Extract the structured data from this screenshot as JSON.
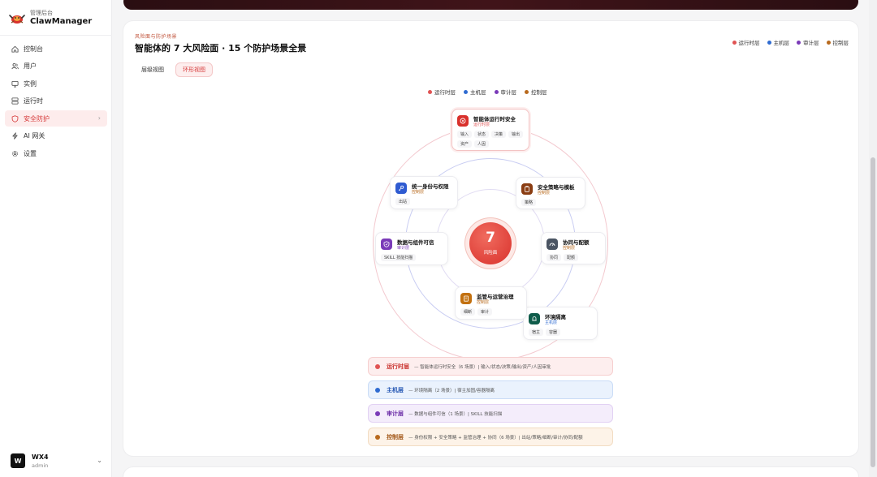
{
  "colors": {
    "runtime": "#e05353",
    "host": "#2f6bd1",
    "audit": "#7a3ab8",
    "control": "#b86a1e",
    "accent": "#d63a3a"
  },
  "sidebar": {
    "brand_sub": "管理后台",
    "brand_title": "ClawManager",
    "items": [
      {
        "label": "控制台",
        "icon": "home-icon"
      },
      {
        "label": "用户",
        "icon": "users-icon"
      },
      {
        "label": "实例",
        "icon": "monitor-icon"
      },
      {
        "label": "运行时",
        "icon": "server-icon"
      },
      {
        "label": "安全防护",
        "icon": "shield-icon",
        "active": true
      },
      {
        "label": "AI 网关",
        "icon": "lightning-icon"
      },
      {
        "label": "设置",
        "icon": "gear-icon"
      }
    ],
    "user": {
      "avatar": "W",
      "name": "WX4",
      "role": "admin"
    }
  },
  "card": {
    "eyebrow": "风险面与防护场景",
    "title": "智能体的 7 大风险面 · 15 个防护场景全景",
    "legend": [
      {
        "label": "运行时层",
        "color": "#e05353"
      },
      {
        "label": "主机层",
        "color": "#2f6bd1"
      },
      {
        "label": "审计层",
        "color": "#7a3ab8"
      },
      {
        "label": "控制层",
        "color": "#b86a1e"
      }
    ],
    "tabs": [
      {
        "label": "层级视图",
        "active": false
      },
      {
        "label": "环形视图",
        "active": true
      }
    ]
  },
  "diagram": {
    "center_number": "7",
    "center_label": "风险面",
    "nodes": [
      {
        "title": "智能体运行时安全",
        "layer": "运行时层",
        "color": "#e05353",
        "icon_bg": "#d9312c",
        "tags": [
          "输入",
          "状态",
          "决策",
          "输出",
          "资产",
          "人因"
        ]
      },
      {
        "title": "安全策略与模板",
        "layer": "控制层",
        "color": "#b86a1e",
        "icon_bg": "#8a3d12",
        "tags": [
          "策略"
        ]
      },
      {
        "title": "协同与配额",
        "layer": "控制层",
        "color": "#b86a1e",
        "icon_bg": "#4b5563",
        "tags": [
          "协同",
          "配额"
        ]
      },
      {
        "title": "环境隔离",
        "layer": "主机层",
        "color": "#2f6bd1",
        "icon_bg": "#0f5c4a",
        "tags": [
          "宿主",
          "容器"
        ]
      },
      {
        "title": "监管与运营治理",
        "layer": "控制层",
        "color": "#b86a1e",
        "icon_bg": "#c2700f",
        "tags": [
          "细断",
          "审计"
        ]
      },
      {
        "title": "数据与组件可信",
        "layer": "审计层",
        "color": "#7a3ab8",
        "icon_bg": "#7a3ab8",
        "tags": [
          "SKILL 技能扫描"
        ]
      },
      {
        "title": "统一身份与权限",
        "layer": "控制层",
        "color": "#b86a1e",
        "icon_bg": "#2f5bd1",
        "tags": [
          "出站"
        ]
      }
    ]
  },
  "rows": [
    {
      "name": "运行时层",
      "desc": "— 智能体运行时安全（6 场景）| 输入/状态/决策/输出/资产/人因审批",
      "color": "#e05353",
      "bg": "#fdeeee",
      "border": "#f6cfcf",
      "text": "#c9302c"
    },
    {
      "name": "主机层",
      "desc": "— 环境隔离（2 场景）| 宿主加固/容器隔离",
      "color": "#2f6bd1",
      "bg": "#eaf2fd",
      "border": "#cadcf6",
      "text": "#2456b3"
    },
    {
      "name": "审计层",
      "desc": "— 数据与组件可信（1 场景）| SKILL 技能扫描",
      "color": "#7a3ab8",
      "bg": "#f4edfb",
      "border": "#e2d1f3",
      "text": "#6a2ca6"
    },
    {
      "name": "控制层",
      "desc": "— 身份权限 + 安全策略 + 监管治理 + 协同（6 场景）| 出站/策略/细断/审计/协同/配额",
      "color": "#b86a1e",
      "bg": "#fdf3e8",
      "border": "#f2dcc2",
      "text": "#a3591a"
    }
  ]
}
